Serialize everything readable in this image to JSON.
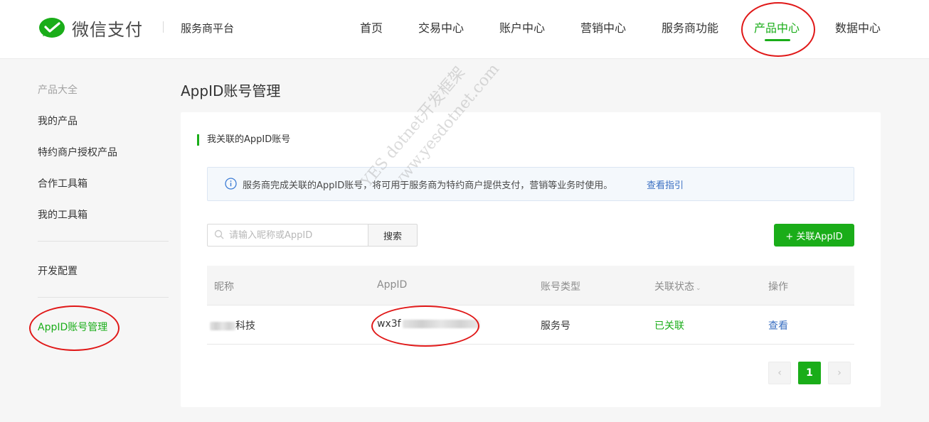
{
  "brand": {
    "name": "微信支付",
    "platform": "服务商平台",
    "logo_icon": "wechat-pay-logo-icon",
    "brand_color": "#1aad19"
  },
  "nav": {
    "items": [
      {
        "label": "首页"
      },
      {
        "label": "交易中心"
      },
      {
        "label": "账户中心"
      },
      {
        "label": "营销中心"
      },
      {
        "label": "服务商功能"
      },
      {
        "label": "产品中心",
        "active": true
      },
      {
        "label": "数据中心"
      }
    ]
  },
  "sidebar": {
    "group_title": "产品大全",
    "items": [
      {
        "label": "我的产品"
      },
      {
        "label": "特约商户授权产品"
      },
      {
        "label": "合作工具箱"
      },
      {
        "label": "我的工具箱"
      },
      {
        "label": "开发配置"
      },
      {
        "label": "AppID账号管理",
        "active": true
      }
    ]
  },
  "page": {
    "title": "AppID账号管理"
  },
  "section": {
    "title": "我关联的AppID账号"
  },
  "notice": {
    "icon": "info-icon",
    "text": "服务商完成关联的AppID账号，将可用于服务商为特约商户提供支付，营销等业务时使用。",
    "link": "查看指引"
  },
  "search": {
    "placeholder": "请输入昵称或AppID",
    "value": "",
    "button": "搜索",
    "icon": "search-icon"
  },
  "add_button": "+ 关联AppID",
  "table": {
    "headers": [
      "昵称",
      "AppID",
      "账号类型",
      "关联状态",
      "操作"
    ],
    "rows": [
      {
        "nickname": "科技",
        "appid": "wx3f",
        "type": "服务号",
        "status": "已关联",
        "action": "查看"
      }
    ]
  },
  "pagination": {
    "prev": "‹",
    "current": "1",
    "next": "›"
  },
  "watermark": {
    "line1": "YES dotnet开发框架",
    "line2": "www.yesdotnet.com"
  },
  "annotation_color": "#e01818"
}
